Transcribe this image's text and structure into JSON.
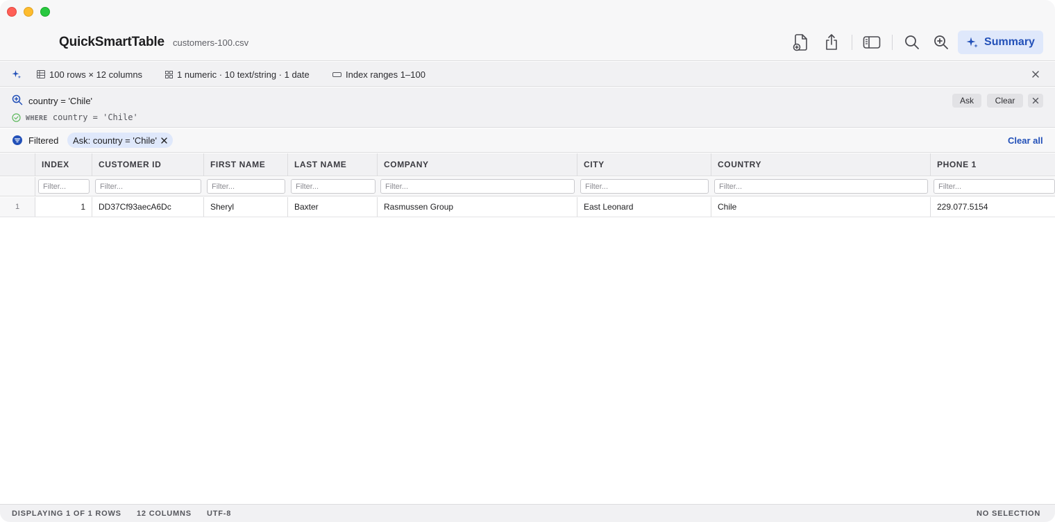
{
  "app": {
    "title": "QuickSmartTable",
    "file_name": "customers-100.csv"
  },
  "toolbar": {
    "icons": [
      "new-file-icon",
      "share-icon",
      "sidebar-icon",
      "search-icon",
      "zoom-in-icon"
    ],
    "summary_label": "Summary",
    "accent_color": "#2250b8"
  },
  "info_bar": {
    "rows_cols": "100 rows × 12 columns",
    "types": "1 numeric · 10 text/string · 1 date",
    "index": "Index ranges 1–100"
  },
  "query": {
    "input": "country = 'Chile'",
    "sql_keyword": "WHERE",
    "sql_clause": "country = 'Chile'",
    "ask_label": "Ask",
    "clear_label": "Clear"
  },
  "filters": {
    "label": "Filtered",
    "chip": "Ask: country = 'Chile'",
    "clear_all": "Clear all"
  },
  "table": {
    "headers": [
      "INDEX",
      "CUSTOMER ID",
      "FIRST NAME",
      "LAST NAME",
      "COMPANY",
      "CITY",
      "COUNTRY",
      "PHONE 1"
    ],
    "filter_placeholder": "Filter...",
    "rows": [
      {
        "row_number": "1",
        "cells": [
          "1",
          "DD37Cf93aecA6Dc",
          "Sheryl",
          "Baxter",
          "Rasmussen Group",
          "East Leonard",
          "Chile",
          "229.077.5154"
        ]
      }
    ]
  },
  "status": {
    "displaying": "DISPLAYING 1 OF 1 ROWS",
    "columns": "12 COLUMNS",
    "encoding": "UTF-8",
    "selection": "NO SELECTION"
  }
}
